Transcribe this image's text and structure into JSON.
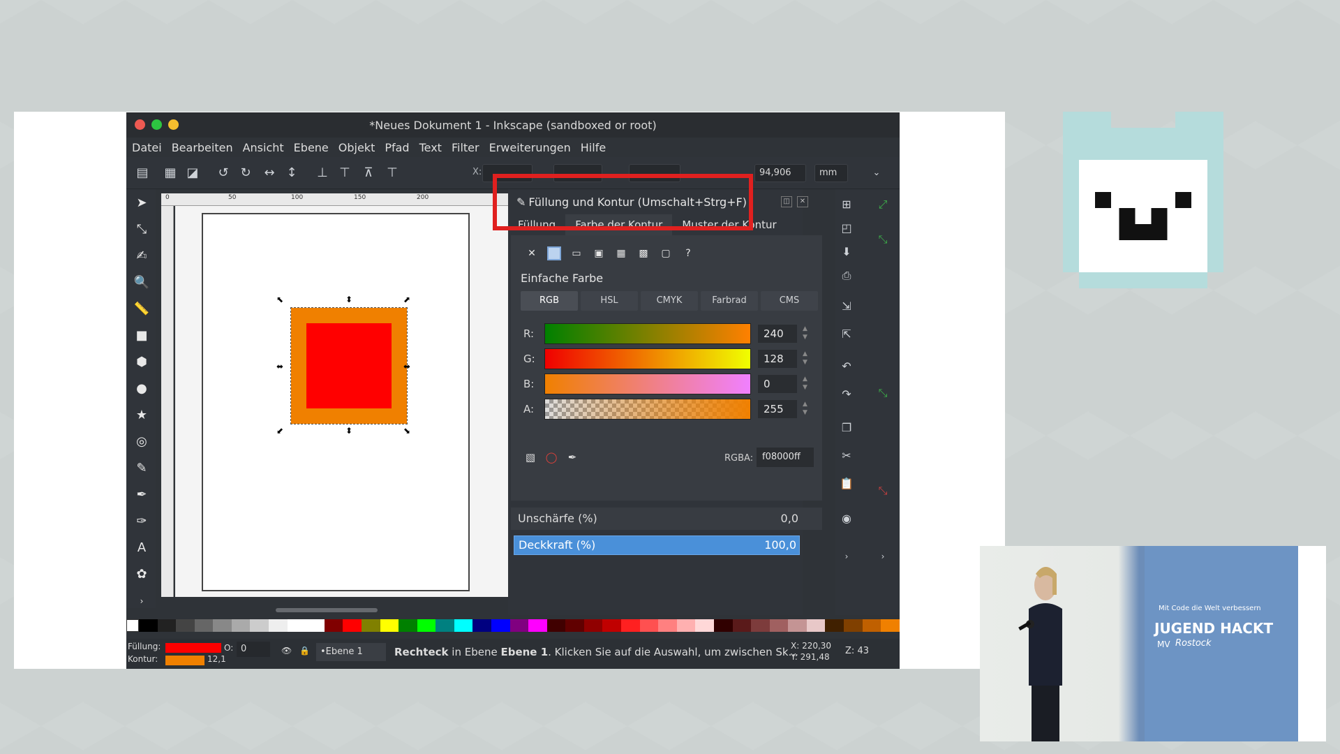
{
  "window": {
    "title": "*Neues Dokument 1 - Inkscape (sandboxed or root)"
  },
  "menu": [
    "Datei",
    "Bearbeiten",
    "Ansicht",
    "Ebene",
    "Objekt",
    "Pfad",
    "Text",
    "Filter",
    "Erweiterungen",
    "Hilfe"
  ],
  "toolbar": {
    "x_label": "X:",
    "height_value": "94,906",
    "unit": "mm"
  },
  "ruler": [
    "0",
    "50",
    "100",
    "150",
    "200"
  ],
  "dialog": {
    "title": "Füllung und Kontur (Umschalt+Strg+F)",
    "tabs": [
      "Füllung",
      "Farbe der Kontur",
      "Muster der Kontur"
    ],
    "section_title": "Einfache Farbe",
    "modes": [
      "RGB",
      "HSL",
      "CMYK",
      "Farbrad",
      "CMS"
    ],
    "channels": [
      {
        "label": "R:",
        "value": "240"
      },
      {
        "label": "G:",
        "value": "128"
      },
      {
        "label": "B:",
        "value": "0"
      },
      {
        "label": "A:",
        "value": "255"
      }
    ],
    "rgba_label": "RGBA:",
    "rgba_value": "f08000ff",
    "blur_label": "Unschärfe (%)",
    "blur_value": "0,0",
    "opacity_label": "Deckkraft (%)",
    "opacity_value": "100,0"
  },
  "statusbar": {
    "fill_label": "Füllung:",
    "stroke_label": "Kontur:",
    "stroke_width": "12,1",
    "opacity_label": "O:",
    "opacity_value": "0",
    "layer": "•Ebene 1",
    "message_bold1": "Rechteck",
    "message_mid": " in Ebene ",
    "message_bold2": "Ebene 1",
    "message_end": ". Klicken Sie auf die Auswahl, um zwischen Sk...",
    "x": "X: 220,30",
    "y": "Y: 291,48",
    "zoom_label": "Z:",
    "zoom": "43"
  },
  "colors": {
    "fill": "#ff0000",
    "stroke": "#f08000",
    "highlight_box": "#e0201f",
    "opacity_bar": "#4a90d9"
  },
  "video": {
    "poster_small": "Mit Code die Welt verbessern",
    "poster_big": "JUGEND HACKT",
    "poster_sub": "MV",
    "poster_script": "Rostock"
  }
}
